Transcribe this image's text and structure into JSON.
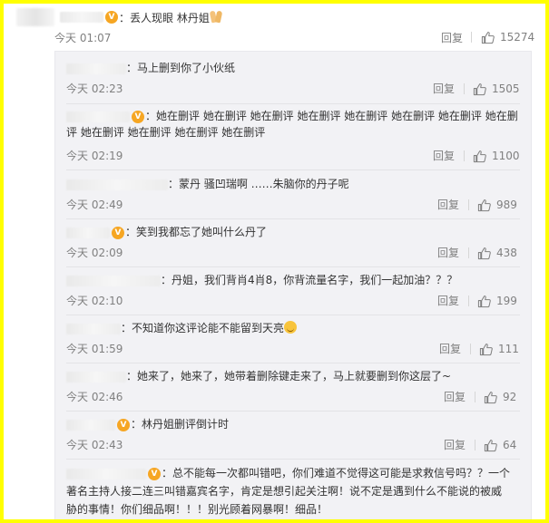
{
  "main_comment": {
    "text": "：丢人现眼 林丹姐",
    "time": "今天 01:07",
    "reply_label": "回复",
    "likes": "15274"
  },
  "replies": [
    {
      "lines": [
        "：马上删到你了小伙纸"
      ],
      "time": "今天 02:23",
      "reply_label": "回复",
      "likes": "1505"
    },
    {
      "lines": [
        "：她在删评 她在删评 她在删评 她在删评  她在删评 她在删评 她在删评 她在删",
        "评 她在删评 她在删评 她在删评 她在删评"
      ],
      "time": "今天 02:19",
      "reply_label": "回复",
      "likes": "1100"
    },
    {
      "lines": [
        "：蒙丹 骚凹瑞啊  ……朱脑你的丹子呢"
      ],
      "time": "今天 02:49",
      "reply_label": "回复",
      "likes": "989"
    },
    {
      "lines": [
        "：笑到我都忘了她叫什么丹了"
      ],
      "time": "今天 02:09",
      "reply_label": "回复",
      "likes": "438"
    },
    {
      "lines": [
        "：丹姐，我们背肖4肖8，你背流量名字，我们一起加油？？？"
      ],
      "time": "今天 02:10",
      "reply_label": "回复",
      "likes": "199"
    },
    {
      "lines": [
        "：不知道你这评论能不能留到天亮"
      ],
      "time": "今天 01:59",
      "reply_label": "回复",
      "likes": "111"
    },
    {
      "lines": [
        "：她来了，她来了，她带着删除键走来了，马上就要删到你这层了~"
      ],
      "time": "今天 02:46",
      "reply_label": "回复",
      "likes": "92"
    },
    {
      "lines": [
        "：林丹姐删评倒计时"
      ],
      "time": "今天 02:43",
      "reply_label": "回复",
      "likes": "64"
    },
    {
      "lines": [
        "：总不能每一次都叫错吧，你们难道不觉得这可能是求救信号吗？？一个",
        "著名主持人接二连三叫错嘉宾名字，肯定是想引起关注啊！说不定是遇到什么不能说的被威",
        "胁的事情！你们细品啊！！！别光顾着网暴啊！细品！"
      ]
    }
  ],
  "colors": {
    "frame": "#ffff00",
    "panel_bg": "#f2f2f5",
    "meta_text": "#808080",
    "body_text": "#333333"
  },
  "icons": {
    "like": "thumbs-up-icon",
    "badge": "vip-badge-icon",
    "emoji_smile": "laughing-emoji-icon",
    "emoji_hands": "praying-hands-emoji-icon"
  }
}
